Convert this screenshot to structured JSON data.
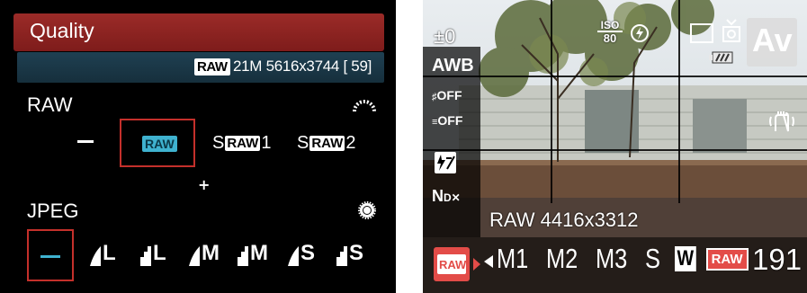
{
  "left_panel": {
    "title": "Quality",
    "info": {
      "raw_badge": "RAW",
      "text": "21M 5616x3744 [ 59]"
    },
    "raw_section": {
      "label": "RAW",
      "options": [
        {
          "label": "—",
          "selected": false
        },
        {
          "label": "RAW",
          "selected": true
        },
        {
          "prefix": "S",
          "badge": "RAW",
          "suffix": "1",
          "selected": false
        },
        {
          "prefix": "S",
          "badge": "RAW",
          "suffix": "2",
          "selected": false
        }
      ],
      "plus": "+"
    },
    "jpeg_section": {
      "label": "JPEG",
      "options": [
        {
          "label": "—",
          "selected": true
        },
        {
          "label": "L",
          "icon": "fine-quality-icon"
        },
        {
          "label": "L",
          "icon": "normal-quality-icon"
        },
        {
          "label": "M",
          "icon": "fine-quality-icon"
        },
        {
          "label": "M",
          "icon": "normal-quality-icon"
        },
        {
          "label": "S",
          "icon": "fine-quality-icon"
        },
        {
          "label": "S",
          "icon": "normal-quality-icon"
        }
      ]
    }
  },
  "right_panel": {
    "exposure_comp": "±0",
    "iso": {
      "top": "ISO",
      "bottom": "80"
    },
    "mode": "Av",
    "side_items": [
      "AWB",
      "OFF",
      "OFF",
      "±",
      "N"
    ],
    "image_size": "RAW 4416x3312",
    "resolution_options": [
      "M1",
      "M2",
      "M3",
      "S",
      "W"
    ],
    "raw_button": "RAW",
    "raw_selected_option": "RAW",
    "shots_remaining": "191"
  },
  "colors": {
    "menu_red": "#8b2320",
    "selection_border": "#c4302b",
    "highlight_cyan": "#3fb2cf",
    "info_bar": "#1c3a4a"
  }
}
